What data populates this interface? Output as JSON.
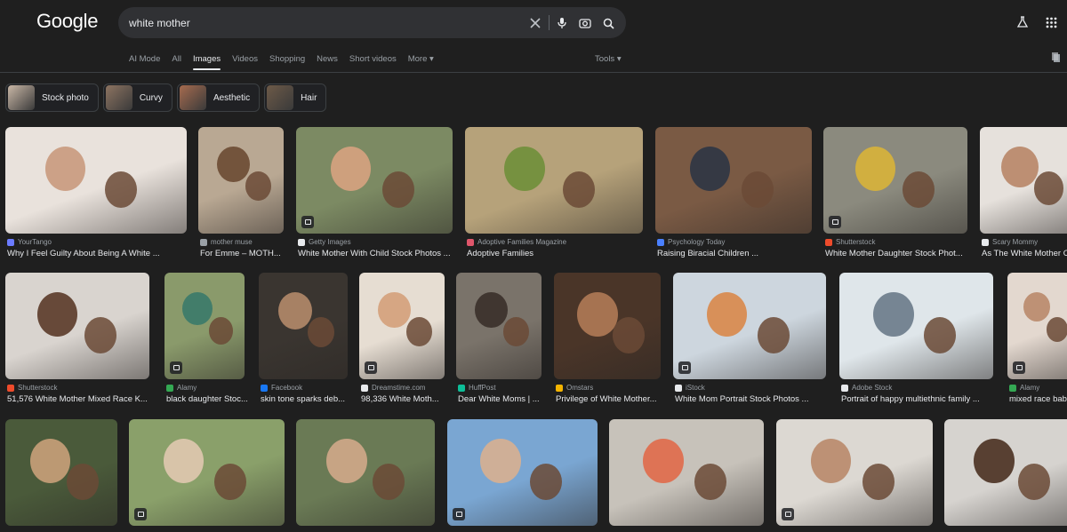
{
  "header": {
    "logo": "Google",
    "query": "white mother"
  },
  "tabs": [
    {
      "label": "AI Mode",
      "active": false
    },
    {
      "label": "All",
      "active": false
    },
    {
      "label": "Images",
      "active": true
    },
    {
      "label": "Videos",
      "active": false
    },
    {
      "label": "Shopping",
      "active": false
    },
    {
      "label": "News",
      "active": false
    },
    {
      "label": "Short videos",
      "active": false
    },
    {
      "label": "More ▾",
      "active": false
    }
  ],
  "tools_label": "Tools ▾",
  "chips": [
    {
      "label": "Stock photo",
      "color": "#c9b7a6"
    },
    {
      "label": "Curvy",
      "color": "#8d7461"
    },
    {
      "label": "Aesthetic",
      "color": "#a66b4f"
    },
    {
      "label": "Hair",
      "color": "#6d5a48"
    }
  ],
  "rows": [
    [
      {
        "source": "YourTango",
        "title": "Why I Feel Guilty About Being A White ...",
        "fav": "#6b7bff",
        "bg": "#e9e2dc",
        "accent": "#c99a7d",
        "badge": false
      },
      {
        "source": "mother muse",
        "title": "For Emme – MOTH...",
        "fav": "#9aa0a6",
        "bg": "#b9a893",
        "accent": "#6b4a33",
        "badge": false
      },
      {
        "source": "Getty Images",
        "title": "White Mother With Child Stock Photos ...",
        "fav": "#e8eaed",
        "bg": "#7c8a63",
        "accent": "#d7a27f",
        "badge": true
      },
      {
        "source": "Adoptive Families Magazine",
        "title": "Adoptive Families",
        "fav": "#e0566b",
        "bg": "#b6a27a",
        "accent": "#6f8f3a",
        "badge": false
      },
      {
        "source": "Psychology Today",
        "title": "Raising Biracial Children ...",
        "fav": "#4a80ff",
        "bg": "#7a5a44",
        "accent": "#2d3545",
        "badge": false
      },
      {
        "source": "Shutterstock",
        "title": "White Mother Daughter Stock Phot...",
        "fav": "#ee4b2b",
        "bg": "#8b8a7e",
        "accent": "#d8b23a",
        "badge": true
      },
      {
        "source": "Scary Mommy",
        "title": "As The White Mother O...",
        "fav": "#e8eaed",
        "bg": "#e6e1dc",
        "accent": "#b88667",
        "badge": false
      }
    ],
    [
      {
        "source": "Shutterstock",
        "title": "51,576 White Mother Mixed Race K...",
        "fav": "#ee4b2b",
        "bg": "#d9d4cf",
        "accent": "#5a3a28",
        "badge": false
      },
      {
        "source": "Alamy",
        "title": "black daughter Stoc...",
        "fav": "#34a853",
        "bg": "#8a9a6b",
        "accent": "#3a7a6a",
        "badge": true
      },
      {
        "source": "Facebook",
        "title": "skin tone sparks deb...",
        "fav": "#1877f2",
        "bg": "#3a3530",
        "accent": "#b48a6a",
        "badge": false
      },
      {
        "source": "Dreamstime.com",
        "title": "98,336 White Moth...",
        "fav": "#e8eaed",
        "bg": "#e6ddd2",
        "accent": "#d4a07a",
        "badge": true
      },
      {
        "source": "HuffPost",
        "title": "Dear White Moms | ...",
        "fav": "#0dbe98",
        "bg": "#7a736a",
        "accent": "#3a302a",
        "badge": false
      },
      {
        "source": "Omstars",
        "title": "Privilege of White Mother...",
        "fav": "#f4b400",
        "bg": "#4a3528",
        "accent": "#b07a55",
        "badge": false
      },
      {
        "source": "iStock",
        "title": "White Mom Portrait Stock Photos ...",
        "fav": "#e8eaed",
        "bg": "#cdd6de",
        "accent": "#d9884a",
        "badge": true
      },
      {
        "source": "Adobe Stock",
        "title": "Portrait of happy multiethnic family ...",
        "fav": "#e8eaed",
        "bg": "#dfe6ea",
        "accent": "#6a7a8a",
        "badge": false
      },
      {
        "source": "Alamy",
        "title": "mixed race baby",
        "fav": "#34a853",
        "bg": "#e3d8cf",
        "accent": "#b98a6a",
        "badge": true
      }
    ],
    [
      {
        "source": "",
        "title": "",
        "fav": "#9aa0a6",
        "bg": "#4a5a3a",
        "accent": "#c9a07a",
        "badge": false
      },
      {
        "source": "",
        "title": "",
        "fav": "#9aa0a6",
        "bg": "#8aa06a",
        "accent": "#e0c8b0",
        "badge": true
      },
      {
        "source": "",
        "title": "",
        "fav": "#9aa0a6",
        "bg": "#6a7a55",
        "accent": "#d2a98a",
        "badge": false
      },
      {
        "source": "",
        "title": "",
        "fav": "#9aa0a6",
        "bg": "#7aa6d2",
        "accent": "#d8b090",
        "badge": true
      },
      {
        "source": "",
        "title": "",
        "fav": "#9aa0a6",
        "bg": "#c7c2ba",
        "accent": "#e06a4a",
        "badge": false
      },
      {
        "source": "",
        "title": "",
        "fav": "#9aa0a6",
        "bg": "#dcd8d2",
        "accent": "#b98a6a",
        "badge": true
      },
      {
        "source": "",
        "title": "",
        "fav": "#9aa0a6",
        "bg": "#d6d3cf",
        "accent": "#4a3020",
        "badge": false
      }
    ]
  ]
}
